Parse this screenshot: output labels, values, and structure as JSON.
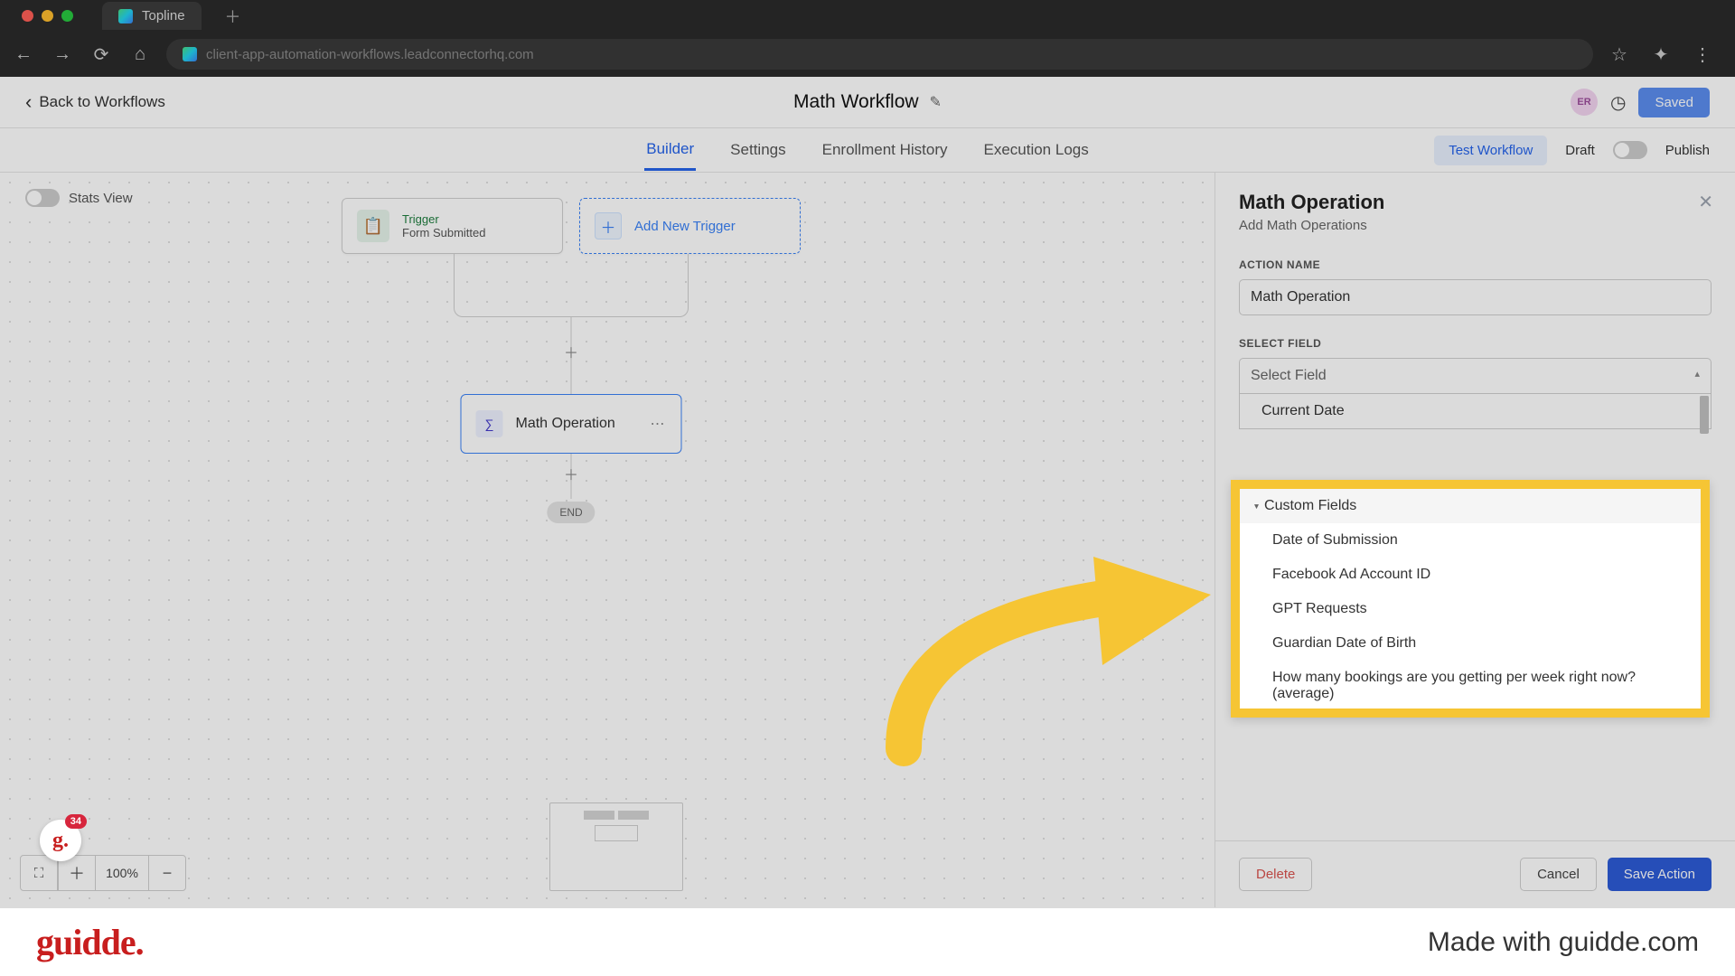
{
  "browser": {
    "tab_title": "Topline",
    "url": "client-app-automation-workflows.leadconnectorhq.com"
  },
  "header": {
    "back": "Back to Workflows",
    "title": "Math Workflow",
    "avatar": "ER",
    "saved": "Saved"
  },
  "tabs": {
    "builder": "Builder",
    "settings": "Settings",
    "enrollment": "Enrollment History",
    "execution": "Execution Logs",
    "test_workflow": "Test Workflow",
    "draft": "Draft",
    "publish": "Publish"
  },
  "canvas": {
    "stats_view": "Stats View",
    "trigger_label": "Trigger",
    "trigger_sub": "Form Submitted",
    "add_trigger": "Add New Trigger",
    "action_label": "Math Operation",
    "end": "END",
    "zoom": "100%"
  },
  "sidepanel": {
    "title": "Math Operation",
    "subtitle": "Add Math Operations",
    "action_name_label": "ACTION NAME",
    "action_name_value": "Math Operation",
    "select_field_label": "SELECT FIELD",
    "select_placeholder": "Select Field",
    "dd_current_date": "Current Date",
    "dd_custom_fields": "Custom Fields",
    "dd_date_submission": "Date of Submission",
    "dd_fb_ad": "Facebook Ad Account ID",
    "dd_gpt": "GPT Requests",
    "dd_guardian": "Guardian Date of Birth",
    "dd_bookings": "How many bookings are you getting per week right now? (average)",
    "delete": "Delete",
    "cancel": "Cancel",
    "save_action": "Save Action"
  },
  "footer": {
    "logo": "guidde.",
    "made_with": "Made with guidde.com"
  },
  "badge": {
    "count": "34"
  }
}
